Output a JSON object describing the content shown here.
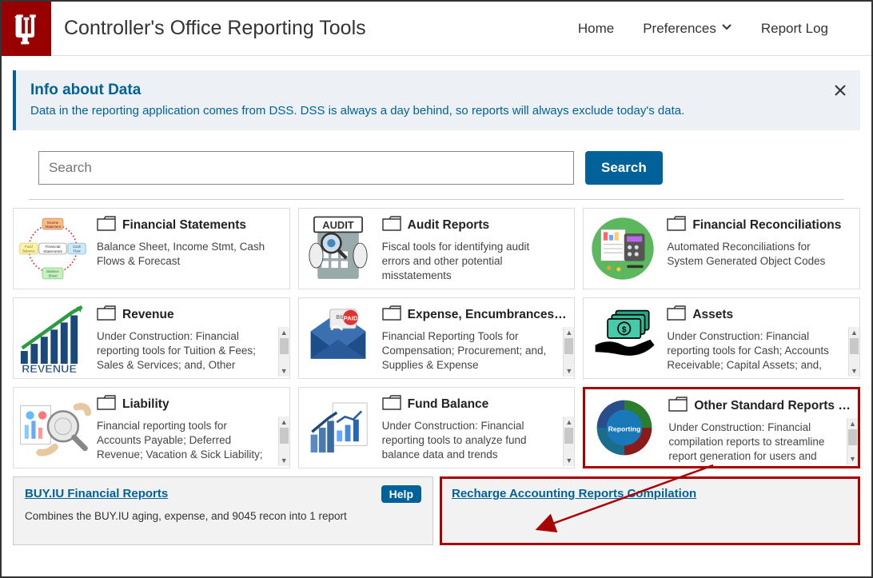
{
  "header": {
    "title": "Controller's Office Reporting Tools",
    "nav": {
      "home": "Home",
      "preferences": "Preferences",
      "report_log": "Report Log"
    }
  },
  "banner": {
    "title": "Info about Data",
    "text": "Data in the reporting application comes from DSS. DSS is always a day behind, so reports will always exclude today's data."
  },
  "search": {
    "placeholder": "Search",
    "button": "Search"
  },
  "cards": [
    {
      "title": "Financial Statements",
      "desc": "Balance Sheet, Income Stmt, Cash Flows & Forecast",
      "scroll": false
    },
    {
      "title": "Audit Reports",
      "desc": "Fiscal tools for identifying audit errors and other potential misstatements",
      "scroll": false
    },
    {
      "title": "Financial Reconciliations",
      "desc": "Automated Reconciliations for System Generated Object Codes",
      "scroll": false
    },
    {
      "title": "Revenue",
      "desc": "Under Construction: Financial reporting tools for Tuition & Fees; Sales & Services; and, Other Revenue",
      "scroll": true
    },
    {
      "title": "Expense, Encumbrances & ...",
      "desc": "Financial Reporting Tools for Compensation; Procurement; and, Supplies & Expense",
      "scroll": true
    },
    {
      "title": "Assets",
      "desc": "Under Construction: Financial reporting tools for Cash; Accounts Receivable; Capital Assets; and, Other",
      "scroll": true
    },
    {
      "title": "Liability",
      "desc": "Financial reporting tools for Accounts Payable; Deferred Revenue; Vacation & Sick Liability; and Other Liabilities",
      "scroll": true
    },
    {
      "title": "Fund Balance",
      "desc": "Under Construction: Financial reporting tools to analyze fund balance data and trends",
      "scroll": true
    },
    {
      "title": "Other Standard Reports a...",
      "desc": "Under Construction: Financial compilation reports to streamline report generation for users and other",
      "scroll": true,
      "highlight": true
    }
  ],
  "bottom": [
    {
      "title": "BUY.IU Financial Reports",
      "desc": "Combines the BUY.IU aging, expense, and 9045 recon into 1 report",
      "help": "Help"
    },
    {
      "title": "Recharge Accounting Reports Compilation",
      "desc": "",
      "highlight": true
    }
  ]
}
